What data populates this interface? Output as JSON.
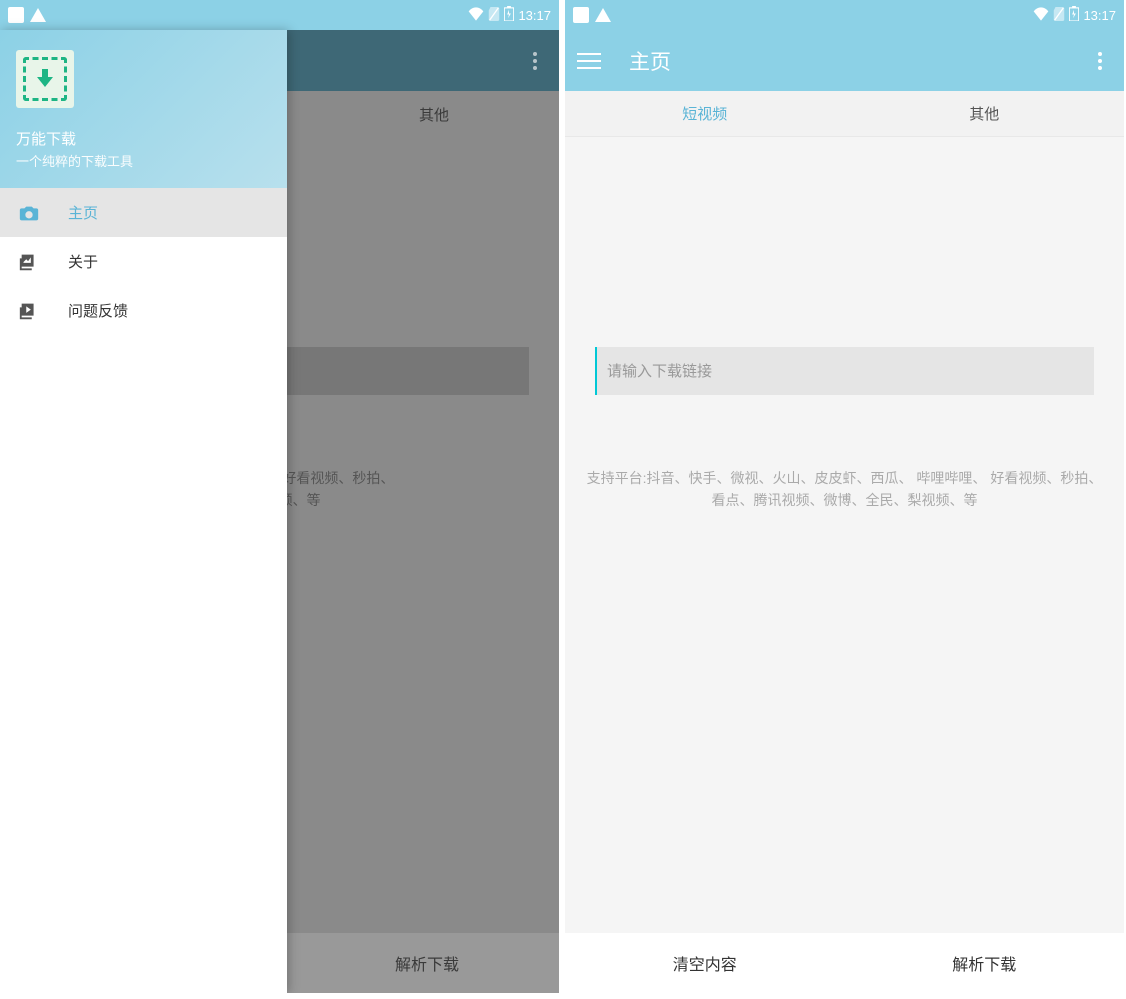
{
  "status": {
    "time": "13:17"
  },
  "appbar": {
    "title": "主页"
  },
  "tabs": [
    {
      "label": "短视频",
      "active": true
    },
    {
      "label": "其他",
      "active": false
    }
  ],
  "input": {
    "placeholder": "请输入下载链接"
  },
  "support_text": "支持平台:抖音、快手、微视、火山、皮皮虾、西瓜、 哔哩哔哩、 好看视频、秒拍、看点、腾讯视频、微博、全民、梨视频、等",
  "dimmed": {
    "tab_other": "其他",
    "support_text_partial": "下、西瓜、 哔哩哔哩、 好看视频、秒拍、\n全民、梨视频、等",
    "parse_btn": "解析下载"
  },
  "bottom": {
    "clear": "清空内容",
    "parse": "解析下载"
  },
  "drawer": {
    "app_name": "万能下载",
    "subtitle": "一个纯粹的下载工具",
    "items": [
      {
        "label": "主页",
        "icon": "camera",
        "active": true
      },
      {
        "label": "关于",
        "icon": "image",
        "active": false
      },
      {
        "label": "问题反馈",
        "icon": "video",
        "active": false
      }
    ]
  }
}
